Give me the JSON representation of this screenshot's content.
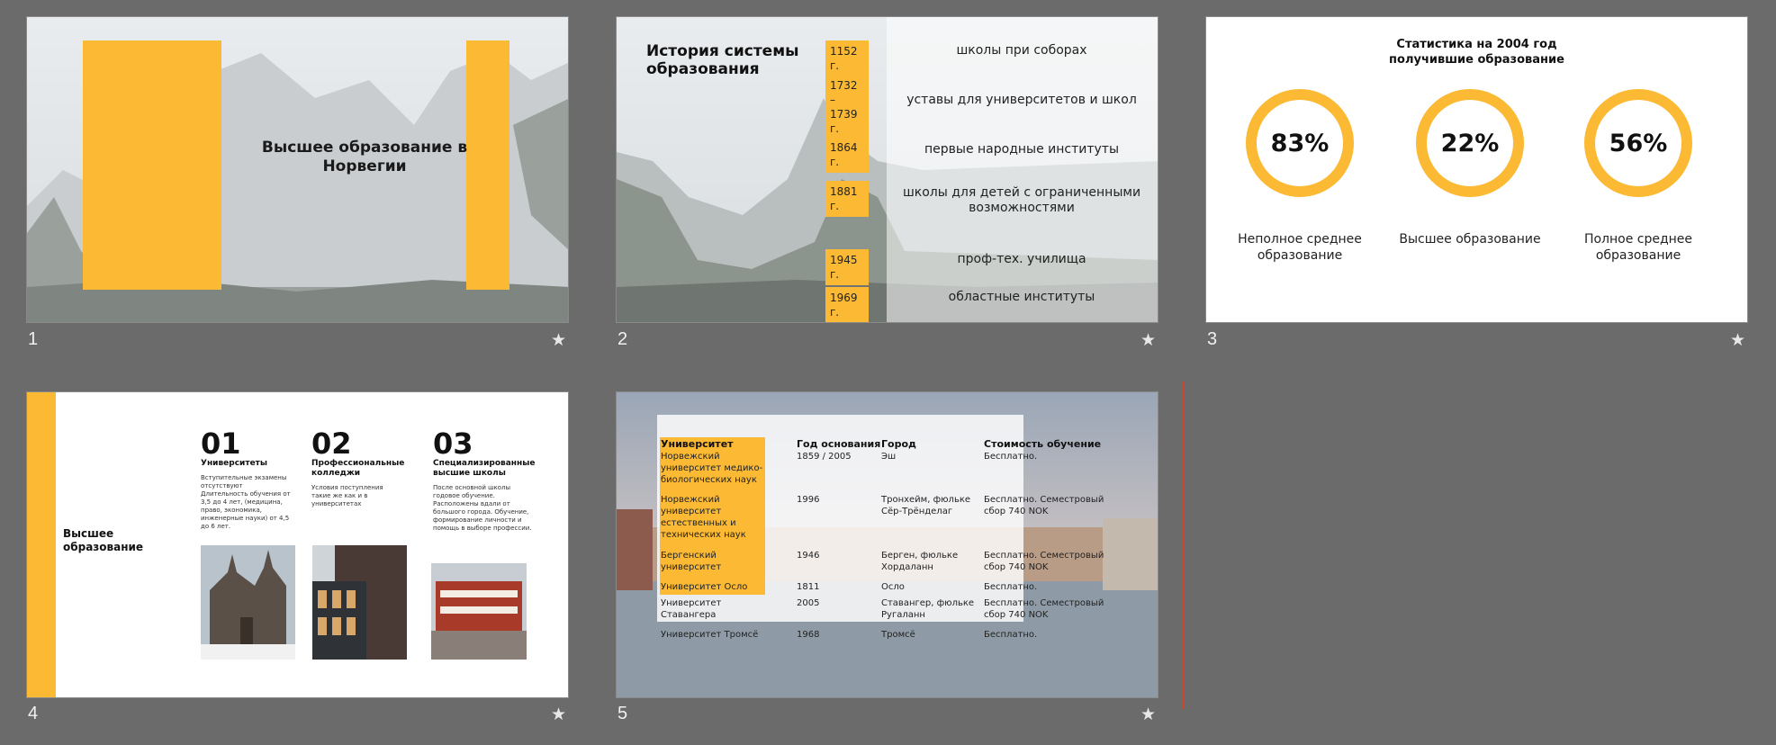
{
  "slides": [
    {
      "number": "1",
      "title": "Высшее образование в Норвегии"
    },
    {
      "number": "2",
      "title": "История системы образования",
      "timeline": [
        {
          "year": "1152 г.",
          "desc": "школы при соборах"
        },
        {
          "year": "1732 – 1739 г.",
          "desc": "уставы для университетов и школ"
        },
        {
          "year": "1864 г.",
          "desc": "первые народные институты"
        },
        {
          "year": "1881 г.",
          "desc": "школы для детей с ограниченными возможностями"
        },
        {
          "year": "1945 г.",
          "desc": "проф-тех. училища"
        },
        {
          "year": "1969 г.",
          "desc": "областные институты"
        }
      ]
    },
    {
      "number": "3",
      "title_line1": "Статистика на 2004 год",
      "title_line2": "получившие образование",
      "stats": [
        {
          "value": "83%",
          "label": "Неполное среднее образование"
        },
        {
          "value": "22%",
          "label": "Высшее образование"
        },
        {
          "value": "56%",
          "label": "Полное среднее образование"
        }
      ]
    },
    {
      "number": "4",
      "heading": "Высшее образование",
      "columns": [
        {
          "num": "01",
          "title": "Университеты",
          "desc": "Вступительные экзамены отсутствуют Длительность обучения от 3,5 до 4 лет, (медицина, право, экономика, инженерные науки) от 4,5 до 6 лет."
        },
        {
          "num": "02",
          "title": "Профессиональные колледжи",
          "desc": "Условия поступления такие же как и в университетах"
        },
        {
          "num": "03",
          "title": "Специализированные высшие школы",
          "desc": "После основной школы годовое обучение. Расположены вдали от большого города. Обучение, формирование личности и помощь в выборе профессии."
        }
      ]
    },
    {
      "number": "5",
      "headers": [
        "Университет",
        "Год основания",
        "Город",
        "Стоимость обучение"
      ],
      "rows": [
        [
          "Норвежский университет медико-биологических наук",
          "1859 / 2005",
          "Эш",
          "Бесплатно."
        ],
        [
          "Норвежский университет естественных и технических наук",
          "1996",
          "Тронхейм, фюльке Сёр-Трёнделаг",
          "Бесплатно. Семестровый сбор 740 NOK"
        ],
        [
          "Бергенский университет",
          "1946",
          "Берген, фюльке Хордаланн",
          "Бесплатно. Семестровый сбор 740 NOK"
        ],
        [
          "Университет Осло",
          "1811",
          "Осло",
          "Бесплатно."
        ],
        [
          "Университет Ставангера",
          "2005",
          "Ставангер, фюльке Ругаланн",
          "Бесплатно. Семестровый сбор 740 NOK"
        ],
        [
          "Университет Тромсё",
          "1968",
          "Тромсё",
          "Бесплатно."
        ]
      ]
    }
  ],
  "colors": {
    "accent": "#fbb934",
    "background": "#6b6b6b"
  },
  "icons": {
    "star": "star-icon"
  }
}
